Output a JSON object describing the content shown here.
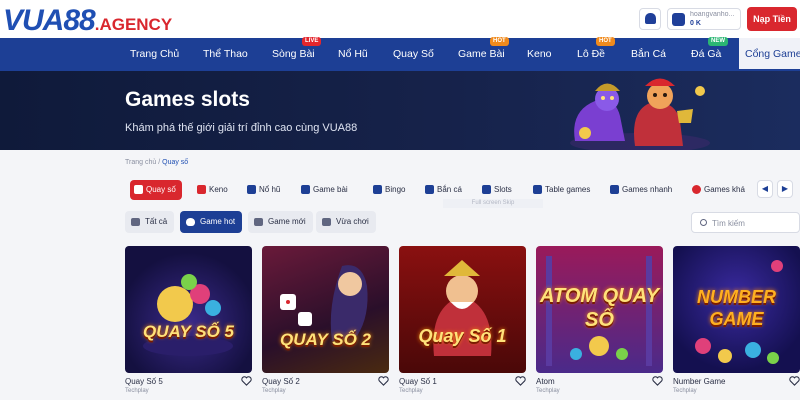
{
  "header": {
    "logo_main": "VUA",
    "logo_num": "88",
    "logo_suffix": ".AGENCY",
    "username": "hoangvanho...",
    "balance": "0 K",
    "deposit_label": "Nạp Tiền",
    "icons": {
      "bell": "bell-icon",
      "user": "user-icon"
    }
  },
  "nav": {
    "items": [
      {
        "label": "Trang Chủ"
      },
      {
        "label": "Thể Thao"
      },
      {
        "label": "Sòng Bài",
        "badge": "LIVE"
      },
      {
        "label": "Nổ Hũ"
      },
      {
        "label": "Quay Số"
      },
      {
        "label": "Game Bài",
        "badge": "HOT"
      },
      {
        "label": "Keno"
      },
      {
        "label": "Lô Đề",
        "badge": "HOT"
      },
      {
        "label": "Bắn Cá"
      },
      {
        "label": "Đá Gà",
        "badge": "NEW"
      },
      {
        "label": "Cổng Game",
        "active": true
      }
    ]
  },
  "banner": {
    "title": "Games slots",
    "subtitle": "Khám phá thế giới giải trí đỉnh cao cùng VUA88"
  },
  "breadcrumb": {
    "home": "Trang chủ",
    "separator": "/",
    "current": "Quay số"
  },
  "categories": {
    "items": [
      {
        "label": "Quay số",
        "active": true,
        "icon": "lottery-icon"
      },
      {
        "label": "Keno",
        "icon": "keno-icon"
      },
      {
        "label": "Nổ hũ",
        "icon": "jackpot-icon"
      },
      {
        "label": "Game bài",
        "icon": "cards-icon"
      },
      {
        "label": "Bingo",
        "icon": "bingo-icon"
      },
      {
        "label": "Bắn cá",
        "icon": "fish-icon"
      },
      {
        "label": "Slots",
        "icon": "slots-icon"
      },
      {
        "label": "Table games",
        "icon": "table-icon"
      },
      {
        "label": "Games nhanh",
        "icon": "rocket-icon"
      },
      {
        "label": "Games khá",
        "icon": "other-games-icon"
      }
    ],
    "hint": "Full screen Skip"
  },
  "filters": {
    "items": [
      {
        "label": "Tất cả",
        "icon": "grid-icon"
      },
      {
        "label": "Game hot",
        "active": true,
        "icon": "flame-icon"
      },
      {
        "label": "Game mới",
        "icon": "new-game-icon"
      },
      {
        "label": "Vừa chơi",
        "icon": "recent-icon"
      }
    ],
    "search_placeholder": "Tìm kiếm"
  },
  "games": [
    {
      "name": "Quay Số 5",
      "provider": "Techplay",
      "art_text": "QUAY SỐ 5"
    },
    {
      "name": "Quay Số 2",
      "provider": "Techplay",
      "art_text": "QUAY SỐ 2"
    },
    {
      "name": "Quay Số 1",
      "provider": "Techplay",
      "art_text": "Quay Số 1"
    },
    {
      "name": "Atom",
      "provider": "Techplay",
      "art_text": "ATOM QUAY SỐ"
    },
    {
      "name": "Number Game",
      "provider": "Techplay",
      "art_text": "NUMBER GAME"
    }
  ],
  "colors": {
    "nav_bg": "#1d3f95",
    "brand_blue": "#1f4fb3",
    "brand_red": "#d9272e",
    "live": "#e4262d",
    "hot": "#f08a1c",
    "new": "#2bb673"
  }
}
